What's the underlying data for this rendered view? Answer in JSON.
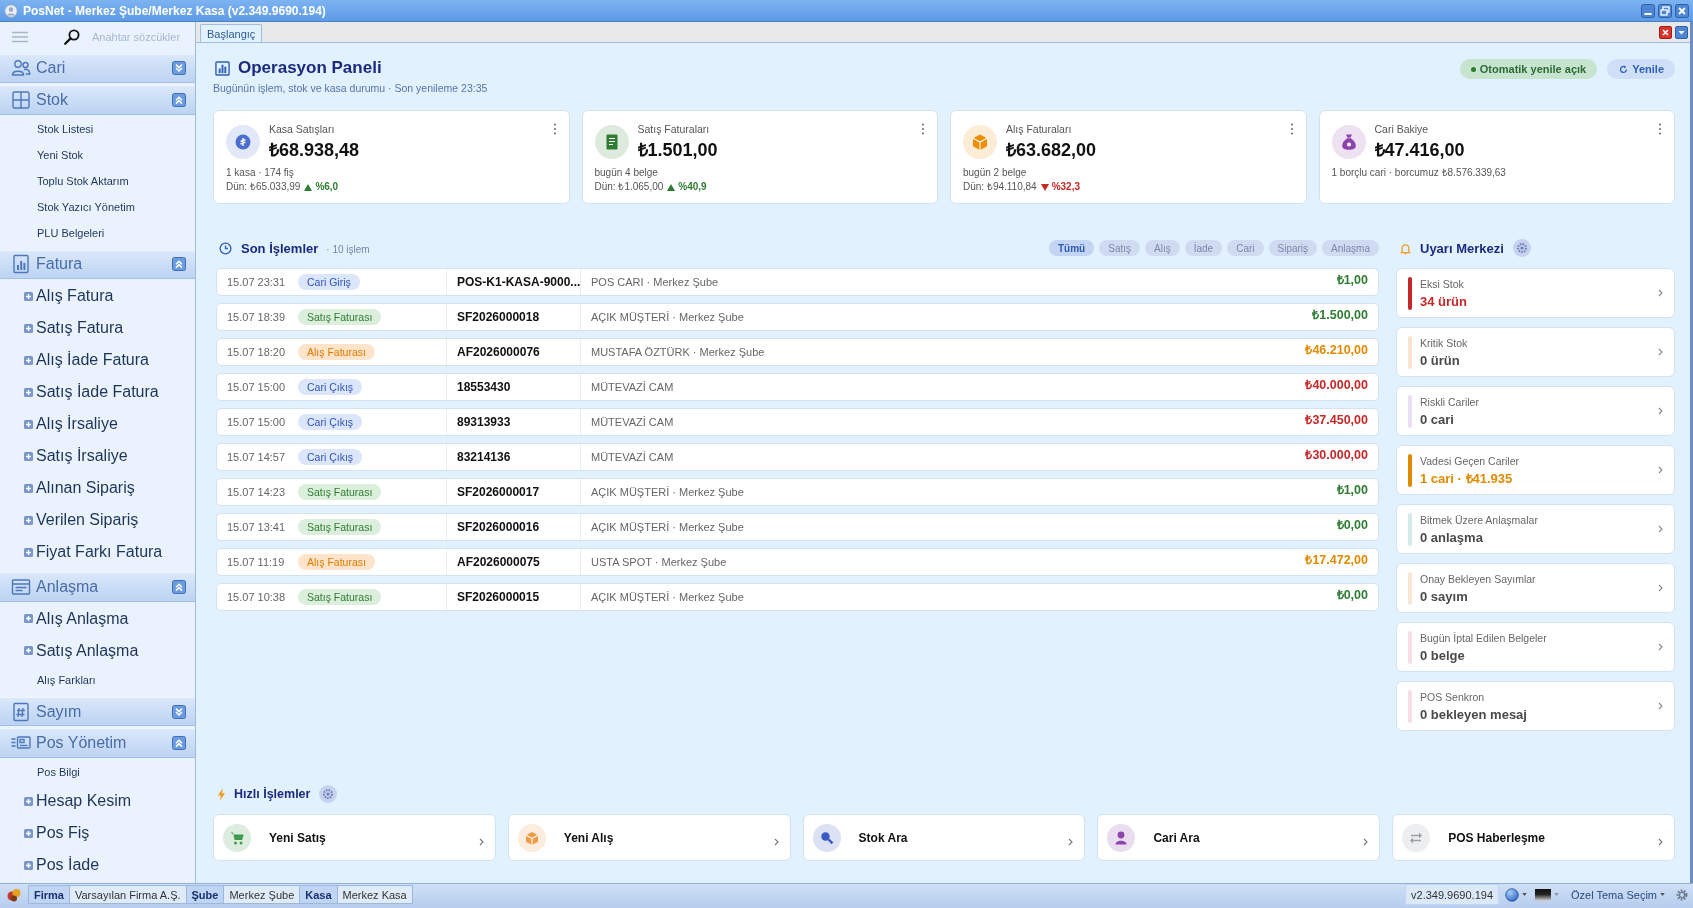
{
  "window": {
    "title": "PosNet - Merkez Şube/Merkez Kasa (v2.349.9690.194)"
  },
  "sidebar": {
    "search": {
      "placeholder": "Anahtar sözcükler"
    },
    "groups": [
      {
        "label": "Cari",
        "expanded": false
      },
      {
        "label": "Stok",
        "expanded": true,
        "items": [
          {
            "label": "Stok Listesi",
            "kind": "link"
          },
          {
            "label": "Yeni Stok",
            "kind": "link"
          },
          {
            "label": "Toplu Stok Aktarım",
            "kind": "link"
          },
          {
            "label": "Stok Yazıcı Yönetim",
            "kind": "link"
          },
          {
            "label": "PLU Belgeleri",
            "kind": "link"
          }
        ]
      },
      {
        "label": "Fatura",
        "expanded": true,
        "items": [
          {
            "label": "Alış Fatura",
            "kind": "module"
          },
          {
            "label": "Satış Fatura",
            "kind": "module"
          },
          {
            "label": "Alış İade Fatura",
            "kind": "module"
          },
          {
            "label": "Satış İade Fatura",
            "kind": "module"
          },
          {
            "label": "Alış İrsaliye",
            "kind": "module"
          },
          {
            "label": "Satış İrsaliye",
            "kind": "module"
          },
          {
            "label": "Alınan Sipariş",
            "kind": "module"
          },
          {
            "label": "Verilen Sipariş",
            "kind": "module"
          },
          {
            "label": "Fiyat Farkı Fatura",
            "kind": "module"
          }
        ]
      },
      {
        "label": "Anlaşma",
        "expanded": true,
        "items": [
          {
            "label": "Alış Anlaşma",
            "kind": "module"
          },
          {
            "label": "Satış Anlaşma",
            "kind": "module"
          },
          {
            "label": "Alış Farkları",
            "kind": "link"
          }
        ]
      },
      {
        "label": "Sayım",
        "expanded": false
      },
      {
        "label": "Pos Yönetim",
        "expanded": true,
        "items": [
          {
            "label": "Pos Bilgi",
            "kind": "link"
          },
          {
            "label": "Hesap Kesim",
            "kind": "module"
          },
          {
            "label": "Pos Fiş",
            "kind": "module"
          },
          {
            "label": "Pos İade",
            "kind": "module"
          }
        ]
      }
    ]
  },
  "tabs": [
    {
      "label": "Başlangıç",
      "selected": true
    }
  ],
  "dashboard": {
    "title": "Operasyon Paneli",
    "subtitle": "Bugünün işlem, stok ve kasa durumu · Son yenileme 23:35",
    "auto_refresh": {
      "label": "Otomatik yenile açık",
      "on": true
    },
    "refresh_button": "Yenile",
    "kpis": [
      {
        "title": "Kasa Satışları",
        "value": "₺68.938,48",
        "color": "#4a6fd1",
        "lines": [
          "1 kasa · 174 fiş"
        ],
        "comparison": {
          "text": "Dün: ₺65.033,99",
          "rising": true,
          "change": "%6,0"
        }
      },
      {
        "title": "Satış Faturaları",
        "value": "₺1.501,00",
        "color": "#2e7d32",
        "lines": [
          "bugün 4 belge"
        ],
        "comparison": {
          "text": "Dün: ₺1.065,00",
          "rising": true,
          "change": "%40,9"
        }
      },
      {
        "title": "Alış Faturaları",
        "value": "₺63.682,00",
        "color": "#f08c00",
        "lines": [
          "bugün 2 belge"
        ],
        "comparison": {
          "text": "Dün: ₺94.110,84",
          "rising": false,
          "change": "%32,3"
        }
      },
      {
        "title": "Cari Bakiye",
        "value": "₺47.416,00",
        "color": "#8e44ad",
        "lines": [
          "1 borçlu cari · borcumuz ₺8.576.339,63"
        ]
      }
    ],
    "recent": {
      "title": "Son İşlemler",
      "count": "· 10 işlem",
      "filters": [
        {
          "label": "Tümü",
          "selected": true
        },
        {
          "label": "Satış",
          "selected": false
        },
        {
          "label": "Alış",
          "selected": false
        },
        {
          "label": "İade",
          "selected": false
        },
        {
          "label": "Cari",
          "selected": false
        },
        {
          "label": "Sipariş",
          "selected": false
        },
        {
          "label": "Anlaşma",
          "selected": false
        }
      ],
      "rows": [
        {
          "time": "15.07 23:31",
          "type": "Cari Giriş",
          "kind": "cari",
          "document": "POS-K1-KASA-9000...",
          "description": "POS CARI · Merkez Şube",
          "amount": "₺1,00",
          "color": "#2e7d32"
        },
        {
          "time": "15.07 18:39",
          "type": "Satış Faturası",
          "kind": "satis",
          "document": "SF2026000018",
          "description": "AÇIK MÜŞTERİ · Merkez Şube",
          "amount": "₺1.500,00",
          "color": "#2e7d32"
        },
        {
          "time": "15.07 18:20",
          "type": "Alış Faturası",
          "kind": "alis",
          "document": "AF2026000076",
          "description": "MUSTAFA ÖZTÜRK · Merkez Şube",
          "amount": "₺46.210,00",
          "color": "#e08a00"
        },
        {
          "time": "15.07 15:00",
          "type": "Cari Çıkış",
          "kind": "cari",
          "document": "18553430",
          "description": "MÜTEVAZİ CAM",
          "amount": "₺40.000,00",
          "color": "#c62828"
        },
        {
          "time": "15.07 15:00",
          "type": "Cari Çıkış",
          "kind": "cari",
          "document": "89313933",
          "description": "MÜTEVAZİ CAM",
          "amount": "₺37.450,00",
          "color": "#c62828"
        },
        {
          "time": "15.07 14:57",
          "type": "Cari Çıkış",
          "kind": "cari",
          "document": "83214136",
          "description": "MÜTEVAZİ CAM",
          "amount": "₺30.000,00",
          "color": "#c62828"
        },
        {
          "time": "15.07 14:23",
          "type": "Satış Faturası",
          "kind": "satis",
          "document": "SF2026000017",
          "description": "AÇIK MÜŞTERİ · Merkez Şube",
          "amount": "₺1,00",
          "color": "#2e7d32"
        },
        {
          "time": "15.07 13:41",
          "type": "Satış Faturası",
          "kind": "satis",
          "document": "SF2026000016",
          "description": "AÇIK MÜŞTERİ · Merkez Şube",
          "amount": "₺0,00",
          "color": "#2e7d32"
        },
        {
          "time": "15.07 11:19",
          "type": "Alış Faturası",
          "kind": "alis",
          "document": "AF2026000075",
          "description": "USTA SPOT · Merkez Şube",
          "amount": "₺17.472,00",
          "color": "#e08a00"
        },
        {
          "time": "15.07 10:38",
          "type": "Satış Faturası",
          "kind": "satis",
          "document": "SF2026000015",
          "description": "AÇIK MÜŞTERİ · Merkez Şube",
          "amount": "₺0,00",
          "color": "#2e7d32"
        }
      ]
    },
    "alerts": {
      "title": "Uyarı Merkezi",
      "items": [
        {
          "title": "Eksi Stok",
          "value": "34 ürün",
          "color": "#c62828",
          "alert": true
        },
        {
          "title": "Kritik Stok",
          "value": "0 ürün",
          "color": "#fbe3cc",
          "alert": false
        },
        {
          "title": "Riskli Cariler",
          "value": "0 cari",
          "color": "#ebdff6",
          "alert": false
        },
        {
          "title": "Vadesi Geçen Cariler",
          "value": "1 cari · ₺41.935",
          "color": "#e08a00",
          "alert": true
        },
        {
          "title": "Bitmek Üzere Anlaşmalar",
          "value": "0 anlaşma",
          "color": "#d5ebe8",
          "alert": false
        },
        {
          "title": "Onay Bekleyen Sayımlar",
          "value": "0 sayım",
          "color": "#fbe6d3",
          "alert": false
        },
        {
          "title": "Bugün İptal Edilen Belgeler",
          "value": "0 belge",
          "color": "#f8dde4",
          "alert": false
        },
        {
          "title": "POS Senkron",
          "value": "0 bekleyen mesaj",
          "color": "#f8dde4",
          "alert": false
        }
      ]
    },
    "quick_actions": {
      "title": "Hızlı İşlemler",
      "items": [
        {
          "label": "Yeni Satış",
          "color": "#3f9a50"
        },
        {
          "label": "Yeni Alış",
          "color": "#ef9a45"
        },
        {
          "label": "Stok Ara",
          "color": "#3b5bc4"
        },
        {
          "label": "Cari Ara",
          "color": "#8e44ad"
        },
        {
          "label": "POS Haberleşme",
          "color": "#9aa0a8"
        }
      ]
    }
  },
  "status_bar": {
    "segments": [
      {
        "label": "Firma",
        "kind": "key"
      },
      {
        "label": "Varsayılan Firma A.Ş.",
        "kind": "value"
      },
      {
        "label": "Şube",
        "kind": "key"
      },
      {
        "label": "Merkez Şube",
        "kind": "value"
      },
      {
        "label": "Kasa",
        "kind": "key"
      },
      {
        "label": "Merkez Kasa",
        "kind": "value"
      }
    ],
    "version": "v2.349.9690.194",
    "theme": "Özel Tema Seçim"
  }
}
